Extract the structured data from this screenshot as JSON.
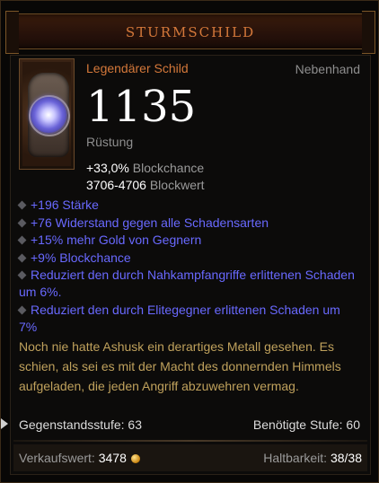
{
  "item": {
    "name": "STURMSCHILD",
    "type": "Legendärer Schild",
    "slot": "Nebenhand",
    "armor_value": "1135",
    "armor_label": "Rüstung"
  },
  "base_stats": [
    {
      "value": "+33,0%",
      "label": "Blockchance"
    },
    {
      "value": "3706-4706",
      "label": "Blockwert"
    }
  ],
  "affixes": [
    "+196 Stärke",
    "+76 Widerstand gegen alle Schadensarten",
    "+15% mehr Gold von Gegnern",
    "+9% Blockchance",
    "Reduziert den durch Nahkampfangriffe erlittenen Schaden um 6%.",
    "Reduziert den durch Elitegegner erlittenen Schaden um 7%"
  ],
  "flavor_text": "Noch nie hatte Ashusk ein derartiges Metall gesehen. Es schien, als sei es mit der Macht des donnernden Himmels aufgeladen, die jeden Angriff abzuwehren vermag.",
  "footer": {
    "item_level": "Gegenstandsstufe: 63",
    "required_level": "Benötigte Stufe: 60"
  },
  "bottom": {
    "sell_label": "Verkaufswert:",
    "sell_value": "3478",
    "durability_label": "Haltbarkeit:",
    "durability_value": "38/38"
  },
  "icons": [
    "shield-item-icon",
    "affix-bullet-icon",
    "gold-coin-icon",
    "mouse-cursor-icon"
  ],
  "colors": {
    "title": "#d4783a",
    "legendary": "#d4783a",
    "affix": "#6969ff",
    "flavor": "#bfa15c",
    "primary_text": "#ffffff",
    "secondary_text": "#9a9a9a"
  }
}
